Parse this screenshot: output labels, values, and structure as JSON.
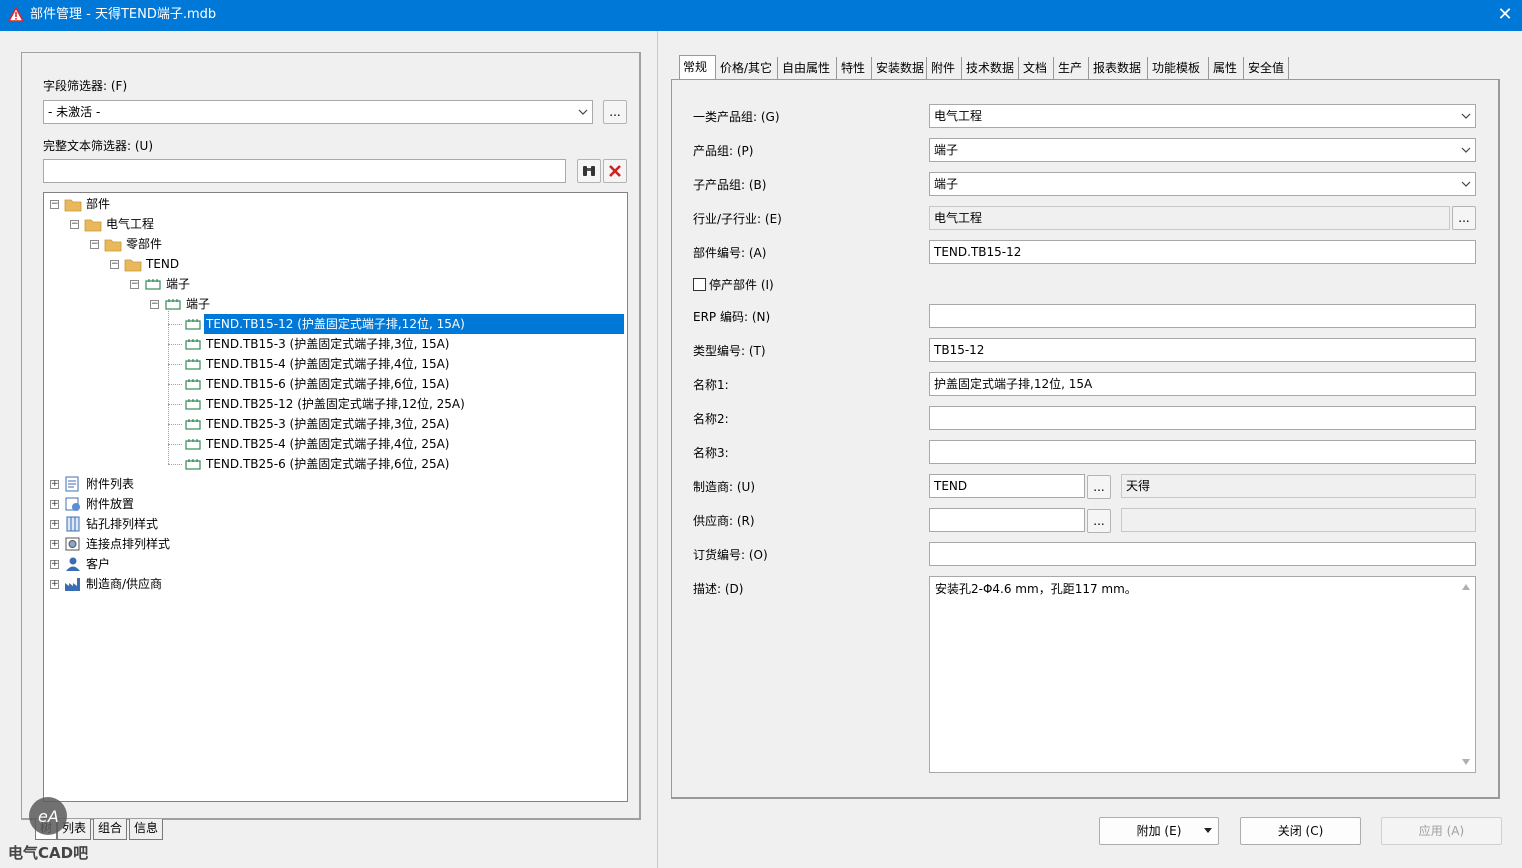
{
  "window": {
    "title": "部件管理 - 天得TEND端子.mdb",
    "close_glyph": "✕"
  },
  "left": {
    "field_filter": {
      "label": "字段筛选器: (F)",
      "value": "- 未激活 -",
      "button": "..."
    },
    "fulltext_filter": {
      "label": "完整文本筛选器: (U)",
      "value": ""
    },
    "tree": [
      {
        "label": "部件",
        "icon": "folder-icon",
        "expander": "−"
      },
      {
        "label": "电气工程",
        "icon": "folder-icon",
        "expander": "−"
      },
      {
        "label": "零部件",
        "icon": "folder-icon",
        "expander": "−"
      },
      {
        "label": "TEND",
        "icon": "folder-icon",
        "expander": "−"
      },
      {
        "label": "端子",
        "icon": "terminal-icon",
        "expander": "−"
      },
      {
        "label": "端子",
        "icon": "terminal-icon",
        "expander": "−"
      },
      {
        "label": "TEND.TB15-12 (护盖固定式端子排,12位, 15A)",
        "icon": "terminal-icon",
        "selected": true
      },
      {
        "label": "TEND.TB15-3 (护盖固定式端子排,3位, 15A)",
        "icon": "terminal-icon"
      },
      {
        "label": "TEND.TB15-4 (护盖固定式端子排,4位, 15A)",
        "icon": "terminal-icon"
      },
      {
        "label": "TEND.TB15-6 (护盖固定式端子排,6位, 15A)",
        "icon": "terminal-icon"
      },
      {
        "label": "TEND.TB25-12 (护盖固定式端子排,12位, 25A)",
        "icon": "terminal-icon"
      },
      {
        "label": "TEND.TB25-3 (护盖固定式端子排,3位, 25A)",
        "icon": "terminal-icon"
      },
      {
        "label": "TEND.TB25-4 (护盖固定式端子排,4位, 25A)",
        "icon": "terminal-icon"
      },
      {
        "label": "TEND.TB25-6 (护盖固定式端子排,6位, 25A)",
        "icon": "terminal-icon"
      },
      {
        "label": "附件列表",
        "icon": "accessory-list-icon",
        "expander": "+"
      },
      {
        "label": "附件放置",
        "icon": "accessory-placement-icon",
        "expander": "+"
      },
      {
        "label": "钻孔排列样式",
        "icon": "drill-pattern-icon",
        "expander": "+"
      },
      {
        "label": "连接点排列样式",
        "icon": "connection-pattern-icon",
        "expander": "+"
      },
      {
        "label": "客户",
        "icon": "customer-icon",
        "expander": "+"
      },
      {
        "label": "制造商/供应商",
        "icon": "manufacturer-icon",
        "expander": "+"
      }
    ],
    "bottom_tabs": [
      "树",
      "列表",
      "组合",
      "信息"
    ]
  },
  "right": {
    "tabs": [
      "常规",
      "价格/其它",
      "自由属性",
      "特性",
      "安装数据",
      "附件",
      "技术数据",
      "文档",
      "生产",
      "报表数据",
      "功能模板",
      "属性",
      "安全值"
    ],
    "fields": {
      "product_group1": {
        "label": "一类产品组: (G)",
        "value": "电气工程"
      },
      "product_group": {
        "label": "产品组: (P)",
        "value": "端子"
      },
      "sub_product_group": {
        "label": "子产品组: (B)",
        "value": "端子"
      },
      "industry": {
        "label": "行业/子行业: (E)",
        "value": "电气工程",
        "button": "..."
      },
      "part_number": {
        "label": "部件编号: (A)",
        "value": "TEND.TB15-12"
      },
      "discontinued": {
        "label": "停产部件 (I)"
      },
      "erp": {
        "label": "ERP 编码: (N)",
        "value": ""
      },
      "type_number": {
        "label": "类型编号: (T)",
        "value": "TB15-12"
      },
      "name1": {
        "label": "名称1:",
        "value": "护盖固定式端子排,12位, 15A"
      },
      "name2": {
        "label": "名称2:",
        "value": ""
      },
      "name3": {
        "label": "名称3:",
        "value": ""
      },
      "manufacturer": {
        "label": "制造商: (U)",
        "value": "TEND",
        "button": "...",
        "name": "天得"
      },
      "supplier": {
        "label": "供应商: (R)",
        "value": "",
        "button": "...",
        "name": ""
      },
      "order_number": {
        "label": "订货编号: (O)",
        "value": ""
      },
      "description": {
        "label": "描述: (D)",
        "value": "安装孔2-Φ4.6 mm，孔距117 mm。"
      }
    },
    "buttons": {
      "add": "附加 (E)",
      "close": "关闭 (C)",
      "apply": "应用 (A)"
    }
  },
  "watermark": {
    "logo": "eA",
    "text": "电气CAD吧"
  },
  "colors": {
    "titlebar": "#0078d7",
    "selection": "#0078d7",
    "folder": "#e8b85a",
    "terminal": "#2e8b57"
  }
}
